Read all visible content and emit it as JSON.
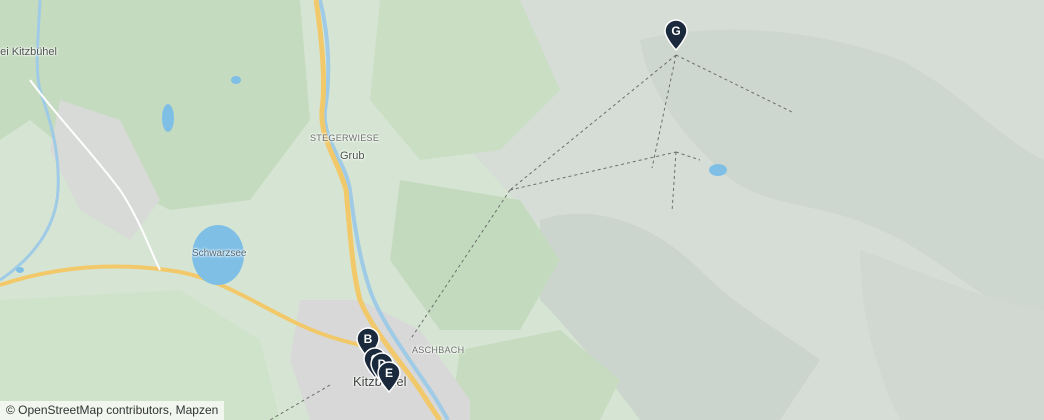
{
  "map": {
    "labels": {
      "kitzbuhel_edge": "bei Kitzbühel",
      "stegerwiese": "STEGERWIESE",
      "grub": "Grub",
      "schwarzsee": "Schwarzsee",
      "aschbach": "ASCHBACH",
      "kitzbuhel": "Kitzbühel"
    },
    "markers": [
      {
        "letter": "B"
      },
      {
        "letter": "C"
      },
      {
        "letter": "D"
      },
      {
        "letter": "E"
      },
      {
        "letter": "G"
      }
    ],
    "attribution": {
      "osm": "© OpenStreetMap contributors",
      "separator": ", ",
      "mapzen": "Mapzen"
    },
    "colors": {
      "marker": "#1a2a3c",
      "water": "#7fbfe6",
      "road": "#f2c96a",
      "forest": "#c6dcc0",
      "mountain": "#d3dcd4"
    }
  }
}
